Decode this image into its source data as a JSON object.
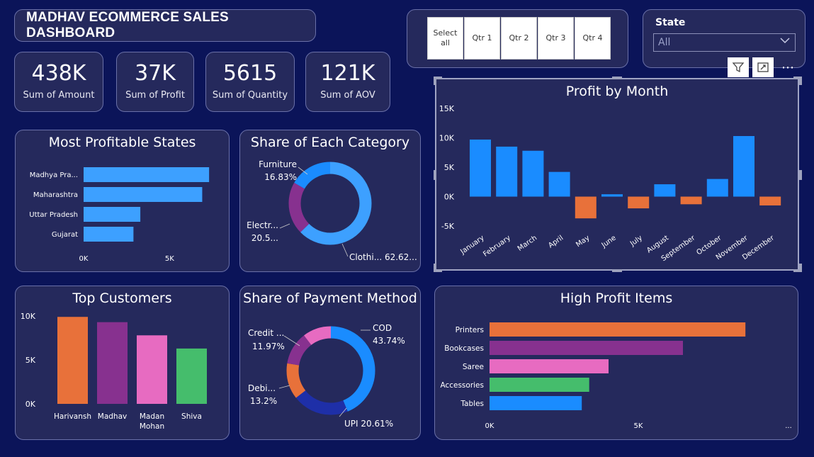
{
  "header": {
    "title": "MADHAV ECOMMERCE SALES DASHBOARD"
  },
  "kpis": [
    {
      "value": "438K",
      "label": "Sum of Amount"
    },
    {
      "value": "37K",
      "label": "Sum of Profit"
    },
    {
      "value": "5615",
      "label": "Sum of Quantity"
    },
    {
      "value": "121K",
      "label": "Sum of AOV"
    }
  ],
  "slicer": {
    "buttons": [
      "Select all",
      "Qtr 1",
      "Qtr 2",
      "Qtr 3",
      "Qtr 4"
    ]
  },
  "state_filter": {
    "label": "State",
    "value": "All"
  },
  "toolbar": {
    "filter_icon": "filter-icon",
    "focus_icon": "focus-mode-icon",
    "more_icon": "more-options-icon",
    "more_label": "⋯"
  },
  "colors": {
    "background": "#0b1459",
    "card": "#25295c",
    "blue": "#1a8cff",
    "light_blue": "#3da0ff",
    "orange": "#e8713a",
    "purple": "#87318f",
    "pink": "#e76bc1",
    "green": "#45bd6c",
    "navy": "#1e2fa8"
  },
  "chart_data": [
    {
      "id": "profitable_states",
      "type": "bar",
      "orientation": "horizontal",
      "title": "Most Profitable States",
      "categories": [
        "Madhya Pra...",
        "Maharashtra",
        "Uttar Pradesh",
        "Gujarat"
      ],
      "values": [
        7300,
        6900,
        3300,
        2900
      ],
      "x_ticks": [
        "0K",
        "5K"
      ],
      "xlim": [
        0,
        7500
      ]
    },
    {
      "id": "category_share",
      "type": "pie",
      "donut": true,
      "title": "Share of Each Category",
      "labels": [
        {
          "name": "Furniture",
          "pct": "16.83%"
        },
        {
          "name": "Electr...",
          "pct": "20.5..."
        },
        {
          "name": "Clothi...",
          "pct": "62.62..."
        }
      ],
      "values": [
        16.83,
        20.55,
        62.62
      ]
    },
    {
      "id": "profit_by_month",
      "type": "bar",
      "title": "Profit by Month",
      "categories": [
        "January",
        "February",
        "March",
        "April",
        "May",
        "June",
        "July",
        "August",
        "September",
        "October",
        "November",
        "December"
      ],
      "values": [
        9700,
        8500,
        7800,
        4200,
        -3700,
        400,
        -2000,
        2100,
        -1300,
        3000,
        10300,
        -1500
      ],
      "y_ticks": [
        "15K",
        "10K",
        "5K",
        "0K",
        "-5K"
      ],
      "ylim": [
        -5000,
        15000
      ]
    },
    {
      "id": "top_customers",
      "type": "bar",
      "title": "Top Customers",
      "categories": [
        "Harivansh",
        "Madhav",
        "Madan Mohan",
        "Shiva"
      ],
      "values": [
        9900,
        9300,
        7800,
        6300
      ],
      "y_ticks": [
        "10K",
        "5K",
        "0K"
      ],
      "ylim": [
        0,
        10000
      ]
    },
    {
      "id": "payment_share",
      "type": "pie",
      "donut": true,
      "title": "Share of Payment Method",
      "labels": [
        {
          "name": "COD",
          "pct": "43.74%"
        },
        {
          "name": "UPI",
          "pct": "20.61%"
        },
        {
          "name": "Debi...",
          "pct": "13.2%"
        },
        {
          "name": "Credit ...",
          "pct": "11.97%"
        }
      ],
      "values": [
        43.74,
        20.61,
        13.2,
        11.97,
        10.48
      ]
    },
    {
      "id": "high_profit_items",
      "type": "bar",
      "orientation": "horizontal",
      "title": "High Profit Items",
      "categories": [
        "Printers",
        "Bookcases",
        "Saree",
        "Accessories",
        "Tables"
      ],
      "values": [
        8600,
        6500,
        4000,
        3350,
        3100
      ],
      "x_ticks": [
        "0K",
        "5K",
        "..."
      ],
      "xlim": [
        0,
        10000
      ]
    }
  ]
}
